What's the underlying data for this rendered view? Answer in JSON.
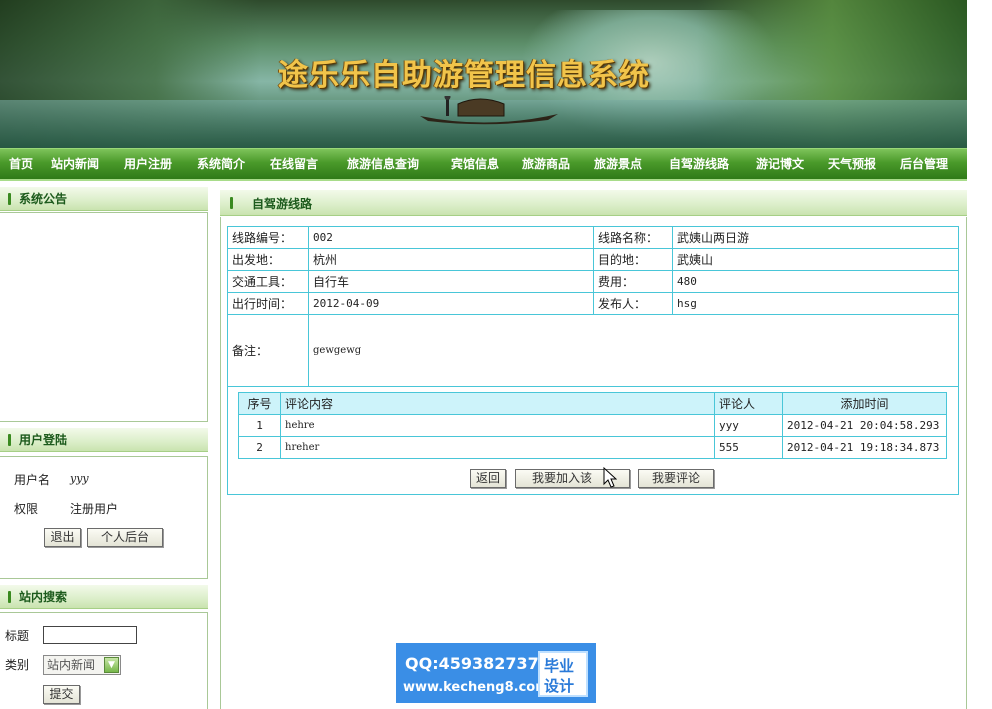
{
  "banner": {
    "title": "途乐乐自助游管理信息系统"
  },
  "nav": {
    "items": [
      "首页",
      "站内新闻",
      "用户注册",
      "系统简介",
      "在线留言",
      "旅游信息查询",
      "宾馆信息",
      "旅游商品",
      "旅游景点",
      "自驾游线路",
      "游记博文",
      "天气预报",
      "后台管理"
    ]
  },
  "sidebar": {
    "notice_title": "系统公告",
    "login": {
      "title": "用户登陆",
      "username_label": "用户名",
      "username_value": "yyy",
      "role_label": "权限",
      "role_value": "注册用户",
      "logout_button": "退出",
      "backend_button": "个人后台"
    },
    "search": {
      "title": "站内搜索",
      "title_label": "标题",
      "title_value": "",
      "category_label": "类别",
      "category_selected": "站内新闻",
      "submit_button": "提交"
    }
  },
  "main": {
    "section_title": "自驾游线路",
    "detail": {
      "route_no_label": "线路编号：",
      "route_no": "002",
      "route_name_label": "线路名称：",
      "route_name": "武姨山两日游",
      "origin_label": "出发地：",
      "origin": "杭州",
      "destination_label": "目的地：",
      "destination": "武姨山",
      "transport_label": "交通工具：",
      "transport": "自行车",
      "cost_label": "费用：",
      "cost": "480",
      "depart_time_label": "出行时间：",
      "depart_time": "2012-04-09",
      "publisher_label": "发布人：",
      "publisher": "hsg",
      "remark_label": "备注：",
      "remark": "gewgewg"
    },
    "comments": {
      "headers": [
        "序号",
        "评论内容",
        "评论人",
        "添加时间"
      ],
      "rows": [
        {
          "no": "1",
          "content": "hehre",
          "user": "yyy",
          "time": "2012-04-21 20:04:58.293"
        },
        {
          "no": "2",
          "content": "hreher",
          "user": "555",
          "time": "2012-04-21 19:18:34.873"
        }
      ]
    },
    "buttons": {
      "back": "返回",
      "join": "我要加入该",
      "comment": "我要评论"
    }
  },
  "watermark": {
    "qq": "QQ:459382737",
    "url": "www.kecheng8.com",
    "badge_line1": "毕业",
    "badge_line2": "设计"
  }
}
